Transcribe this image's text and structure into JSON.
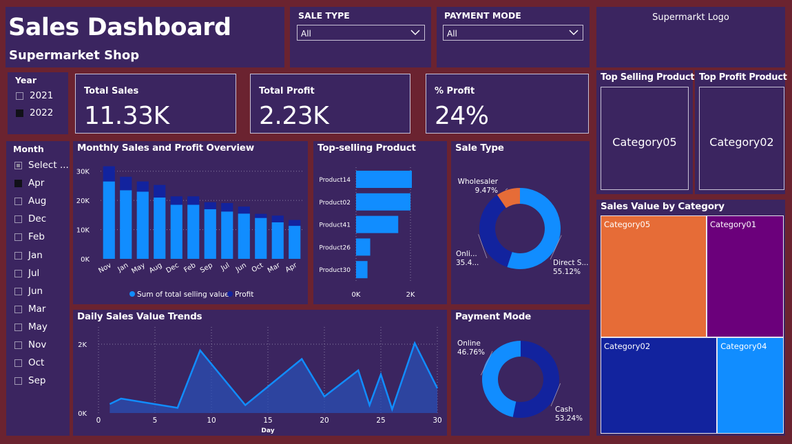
{
  "header": {
    "title": "Sales Dashboard",
    "subtitle": "Supermarket Shop"
  },
  "filters": {
    "sale_type": {
      "label": "SALE TYPE",
      "value": "All"
    },
    "payment_mode": {
      "label": "PAYMENT MODE",
      "value": "All"
    }
  },
  "logo": {
    "text": "Supermarkt Logo"
  },
  "year_slicer": {
    "label": "Year",
    "items": [
      {
        "label": "2021",
        "checked": false
      },
      {
        "label": "2022",
        "checked": true
      }
    ]
  },
  "kpis": {
    "total_sales": {
      "label": "Total Sales",
      "value": "11.33K"
    },
    "total_profit": {
      "label": "Total Profit",
      "value": "2.23K"
    },
    "pct_profit": {
      "label": "% Profit",
      "value": "24%"
    }
  },
  "top_cards": {
    "top_selling": {
      "label": "Top Selling Product",
      "value": "Category05"
    },
    "top_profit": {
      "label": "Top Profit Product",
      "value": "Category02"
    }
  },
  "month_slicer": {
    "label": "Month",
    "items": [
      {
        "label": "Select ...",
        "state": "partial"
      },
      {
        "label": "Apr",
        "state": "on"
      },
      {
        "label": "Aug",
        "state": "off"
      },
      {
        "label": "Dec",
        "state": "off"
      },
      {
        "label": "Feb",
        "state": "off"
      },
      {
        "label": "Jan",
        "state": "off"
      },
      {
        "label": "Jul",
        "state": "off"
      },
      {
        "label": "Jun",
        "state": "off"
      },
      {
        "label": "Mar",
        "state": "off"
      },
      {
        "label": "May",
        "state": "off"
      },
      {
        "label": "Nov",
        "state": "off"
      },
      {
        "label": "Oct",
        "state": "off"
      },
      {
        "label": "Sep",
        "state": "off"
      }
    ]
  },
  "colors": {
    "background": "#6b2330",
    "panel": "#3b2560",
    "light_blue": "#118dff",
    "dark_blue": "#12239e",
    "orange": "#e66c37",
    "purple": "#6b007b",
    "grid": "#8a7fa3"
  },
  "chart_data": [
    {
      "id": "monthly",
      "type": "bar",
      "title": "Monthly Sales and Profit Overview",
      "stacked": true,
      "categories": [
        "Nov",
        "Jan",
        "May",
        "Aug",
        "Dec",
        "Feb",
        "Sep",
        "Jul",
        "Jun",
        "Oct",
        "Mar",
        "Apr"
      ],
      "series": [
        {
          "name": "Sum of total selling value",
          "color": "#118dff",
          "values": [
            26500,
            23500,
            23000,
            21000,
            18500,
            18500,
            17000,
            16200,
            15500,
            14000,
            12500,
            11300
          ]
        },
        {
          "name": "Profit",
          "color": "#12239e",
          "values": [
            5200,
            4600,
            3500,
            4300,
            2900,
            2900,
            2400,
            2900,
            2400,
            1400,
            2300,
            2000
          ]
        }
      ],
      "yticks": [
        "0K",
        "10K",
        "20K",
        "30K"
      ],
      "ytick_values": [
        0,
        10000,
        20000,
        30000
      ],
      "ylim": [
        0,
        33000
      ],
      "grid": true,
      "legend": "bottom"
    },
    {
      "id": "topsell",
      "type": "bar",
      "orientation": "horizontal",
      "title": "Top-selling Product",
      "categories": [
        "Product14",
        "Product02",
        "Product41",
        "Product26",
        "Product30"
      ],
      "values": [
        2050,
        2000,
        1550,
        520,
        420
      ],
      "xticks": [
        "0K",
        "2K"
      ],
      "xtick_values": [
        0,
        2000
      ],
      "xlim": [
        0,
        2050
      ]
    },
    {
      "id": "saletype",
      "type": "pie",
      "donut": true,
      "title": "Sale Type",
      "slices": [
        {
          "label": "Direct S...",
          "pct": "55.12%",
          "value": 55.12,
          "color": "#118dff"
        },
        {
          "label": "Onli...",
          "pct": "35.4...",
          "value": 35.41,
          "color": "#12239e"
        },
        {
          "label": "Wholesaler",
          "pct": "9.47%",
          "value": 9.47,
          "color": "#e66c37"
        }
      ]
    },
    {
      "id": "payment",
      "type": "pie",
      "donut": true,
      "title": "Payment Mode",
      "slices": [
        {
          "label": "Cash",
          "pct": "53.24%",
          "value": 53.24,
          "color": "#12239e"
        },
        {
          "label": "Online",
          "pct": "46.76%",
          "value": 46.76,
          "color": "#118dff"
        }
      ]
    },
    {
      "id": "daily",
      "type": "area",
      "title": "Daily Sales Value Trends",
      "xlabel": "Day",
      "x": [
        1,
        2,
        7,
        9,
        13,
        18,
        20,
        23,
        24,
        25,
        26,
        28,
        30
      ],
      "y": [
        260,
        420,
        150,
        1820,
        230,
        1570,
        480,
        1240,
        230,
        1120,
        110,
        2030,
        720
      ],
      "xticks": [
        "0",
        "5",
        "10",
        "15",
        "20",
        "25",
        "30"
      ],
      "xtick_values": [
        0,
        5,
        10,
        15,
        20,
        25,
        30
      ],
      "yticks": [
        "0K",
        "2K"
      ],
      "ytick_values": [
        0,
        2000
      ],
      "xlim": [
        0,
        30
      ],
      "ylim": [
        0,
        2500
      ],
      "grid": true
    },
    {
      "id": "treemap",
      "type": "treemap",
      "title": "Sales Value by Category",
      "items": [
        {
          "label": "Category05",
          "value": 3300,
          "color": "#e66c37"
        },
        {
          "label": "Category01",
          "value": 2400,
          "color": "#6b007b"
        },
        {
          "label": "Category02",
          "value": 2850,
          "color": "#12239e"
        },
        {
          "label": "Category04",
          "value": 1630,
          "color": "#118dff"
        }
      ]
    }
  ]
}
